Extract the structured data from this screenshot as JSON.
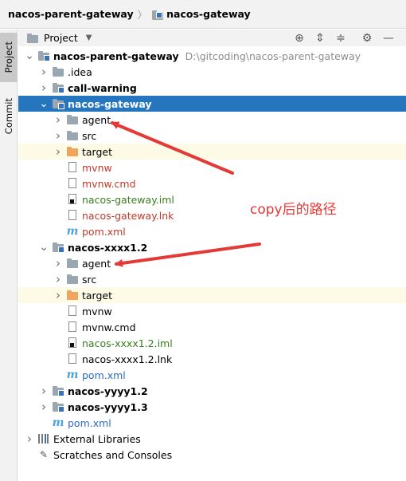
{
  "breadcrumb": {
    "items": [
      "nacos-parent-gateway",
      "nacos-gateway"
    ]
  },
  "sidebar": {
    "tabs": [
      {
        "label": "Project",
        "active": true
      },
      {
        "label": "Commit",
        "active": false
      }
    ]
  },
  "panel": {
    "title": "Project",
    "tools": [
      "locate-icon",
      "expand-all-icon",
      "collapse-all-icon",
      "settings-icon",
      "hide-icon"
    ]
  },
  "tree": [
    {
      "depth": 0,
      "arrow": "down",
      "icon": "folder-module",
      "label": "nacos-parent-gateway",
      "path": "D:\\gitcoding\\nacos-parent-gateway",
      "style": "bold"
    },
    {
      "depth": 1,
      "arrow": "right",
      "icon": "folder",
      "label": ".idea"
    },
    {
      "depth": 1,
      "arrow": "right",
      "icon": "folder-module",
      "label": "call-warning",
      "style": "bold"
    },
    {
      "depth": 1,
      "arrow": "down",
      "icon": "folder-module",
      "label": "nacos-gateway",
      "style": "bold",
      "selected": true
    },
    {
      "depth": 2,
      "arrow": "right",
      "icon": "folder",
      "label": "agent"
    },
    {
      "depth": 2,
      "arrow": "right",
      "icon": "folder",
      "label": "src"
    },
    {
      "depth": 2,
      "arrow": "right",
      "icon": "folder-orange",
      "label": "target",
      "highlight": true
    },
    {
      "depth": 2,
      "arrow": "none",
      "icon": "file",
      "label": "mvnw",
      "color": "red"
    },
    {
      "depth": 2,
      "arrow": "none",
      "icon": "file",
      "label": "mvnw.cmd",
      "color": "red"
    },
    {
      "depth": 2,
      "arrow": "none",
      "icon": "file-iml",
      "label": "nacos-gateway.iml",
      "color": "green"
    },
    {
      "depth": 2,
      "arrow": "none",
      "icon": "file",
      "label": "nacos-gateway.lnk",
      "color": "red"
    },
    {
      "depth": 2,
      "arrow": "none",
      "icon": "maven",
      "label": "pom.xml",
      "color": "red"
    },
    {
      "depth": 1,
      "arrow": "down",
      "icon": "folder-module",
      "label": "nacos-xxxx1.2",
      "style": "bold"
    },
    {
      "depth": 2,
      "arrow": "right",
      "icon": "folder",
      "label": "agent"
    },
    {
      "depth": 2,
      "arrow": "right",
      "icon": "folder",
      "label": "src"
    },
    {
      "depth": 2,
      "arrow": "right",
      "icon": "folder-orange",
      "label": "target",
      "highlight": true
    },
    {
      "depth": 2,
      "arrow": "none",
      "icon": "file",
      "label": "mvnw"
    },
    {
      "depth": 2,
      "arrow": "none",
      "icon": "file",
      "label": "mvnw.cmd"
    },
    {
      "depth": 2,
      "arrow": "none",
      "icon": "file-iml",
      "label": "nacos-xxxx1.2.iml",
      "color": "green"
    },
    {
      "depth": 2,
      "arrow": "none",
      "icon": "file",
      "label": "nacos-xxxx1.2.lnk"
    },
    {
      "depth": 2,
      "arrow": "none",
      "icon": "maven",
      "label": "pom.xml",
      "color": "blue"
    },
    {
      "depth": 1,
      "arrow": "right",
      "icon": "folder-module",
      "label": "nacos-yyyy1.2",
      "style": "bold"
    },
    {
      "depth": 1,
      "arrow": "right",
      "icon": "folder-module",
      "label": "nacos-yyyy1.3",
      "style": "bold"
    },
    {
      "depth": 1,
      "arrow": "none",
      "icon": "maven",
      "label": "pom.xml",
      "color": "blue"
    },
    {
      "depth": 0,
      "arrow": "right",
      "icon": "library",
      "label": "External Libraries"
    },
    {
      "depth": 0,
      "arrow": "none",
      "icon": "scratches",
      "label": "Scratches and Consoles"
    }
  ],
  "annotation": {
    "text": "copy后的路径",
    "color": "#e53935"
  },
  "colors": {
    "selection": "#2675bf",
    "excluded_highlight": "#fdfbe6",
    "module_bold": "#000000",
    "unversioned_red": "#c0392b",
    "added_green": "#3a7d1f",
    "modified_blue": "#2c6bc5"
  }
}
